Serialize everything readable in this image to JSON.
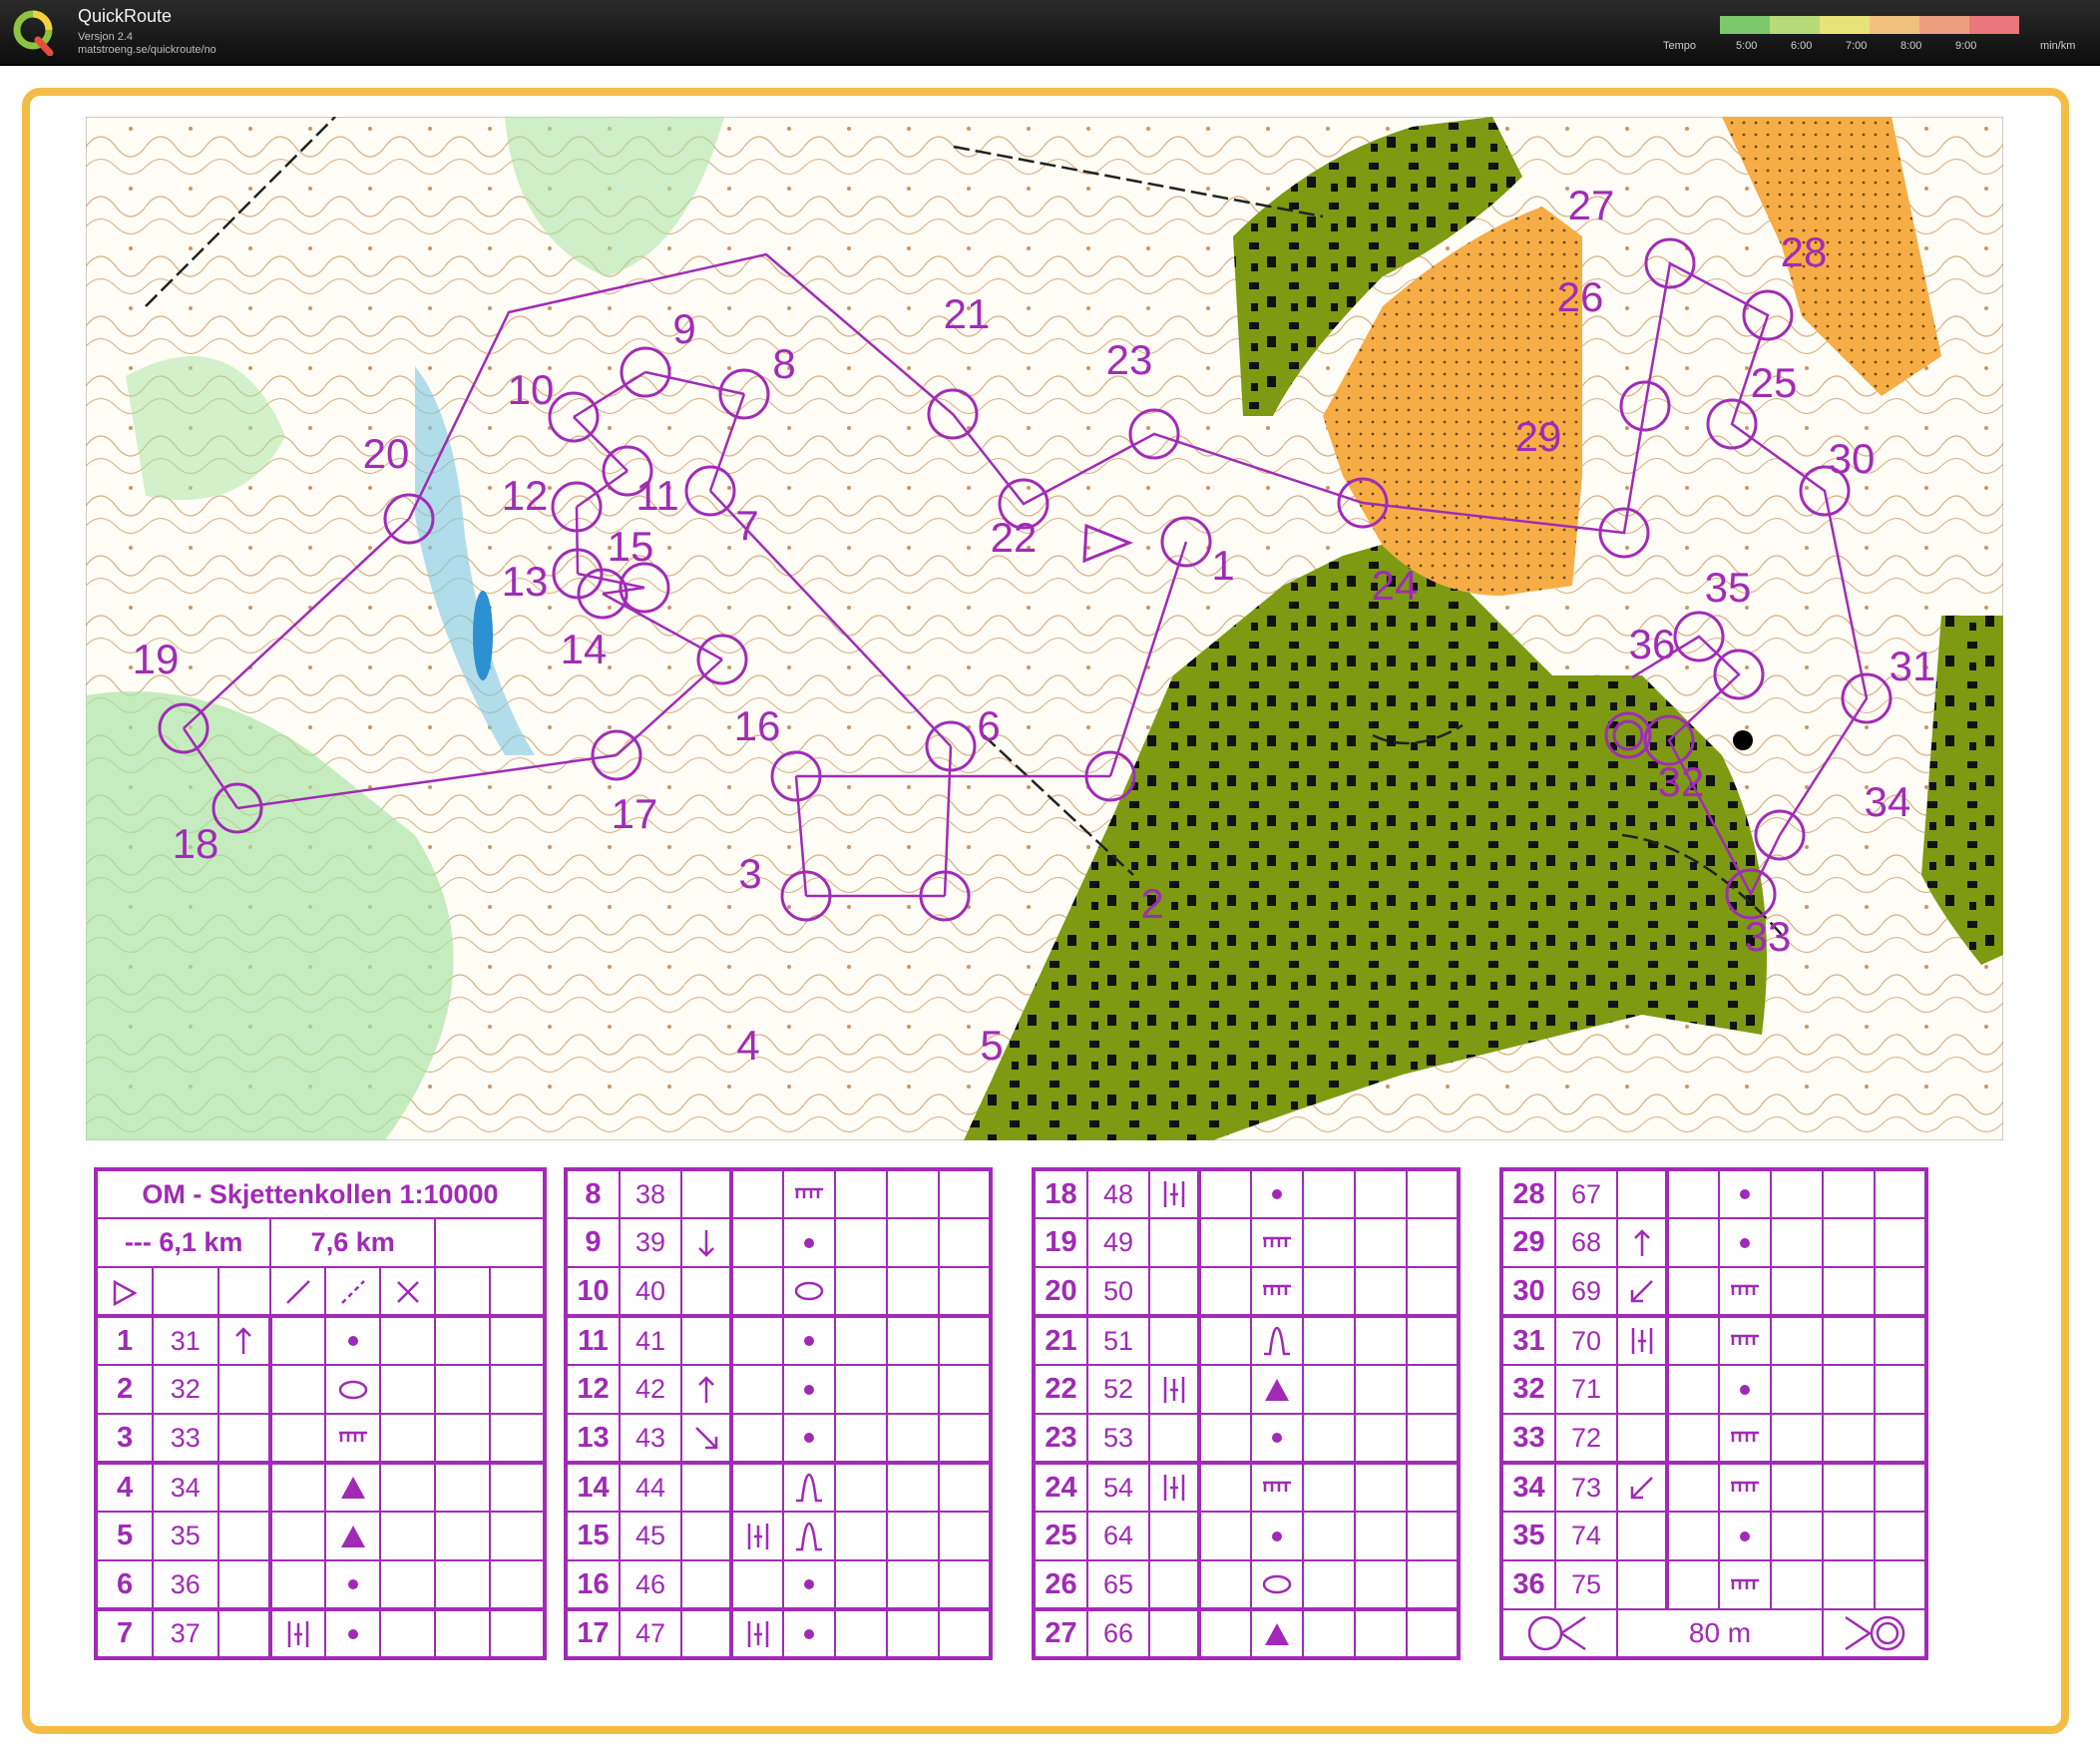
{
  "app": {
    "title": "QuickRoute",
    "version": "Versjon 2.4",
    "url": "matstroeng.se/quickroute/no",
    "tempo_label": "Tempo",
    "tempo_ticks": [
      "5:00",
      "6:00",
      "7:00",
      "8:00",
      "9:00"
    ],
    "tempo_unit": "min/km",
    "tempo_colors": [
      "#7bc96a",
      "#b8db79",
      "#e8e27a",
      "#f2c27c",
      "#ee9f7f",
      "#e8767a"
    ]
  },
  "map": {
    "control_labels": [
      "1",
      "2",
      "3",
      "4",
      "5",
      "6",
      "7",
      "8",
      "9",
      "10",
      "11",
      "12",
      "13",
      "14",
      "15",
      "16",
      "17",
      "18",
      "19",
      "20",
      "21",
      "22",
      "23",
      "24",
      "25",
      "26",
      "27",
      "28",
      "29",
      "30",
      "31",
      "32",
      "33",
      "34",
      "35",
      "36"
    ],
    "colors": {
      "course": "#a12bb7",
      "forest": "#ffffff",
      "open": "#f7ad45",
      "green": "#9fe09a",
      "urban": "#7d9a12",
      "contour": "#b36a2a",
      "water": "#58b8d8"
    }
  },
  "descriptions": {
    "title": "OM - Skjettenkollen 1:10000",
    "length_a": "--- 6,1 km",
    "length_b": "7,6 km",
    "finish_distance": "80 m",
    "rows": [
      {
        "n": "1",
        "c": "31",
        "dir": "up",
        "col": "",
        "f": "dot"
      },
      {
        "n": "2",
        "c": "32",
        "dir": "",
        "col": "",
        "f": "ellipse"
      },
      {
        "n": "3",
        "c": "33",
        "dir": "",
        "col": "",
        "f": "comb"
      },
      {
        "n": "4",
        "c": "34",
        "dir": "",
        "col": "",
        "f": "triangle"
      },
      {
        "n": "5",
        "c": "35",
        "dir": "",
        "col": "",
        "f": "triangle"
      },
      {
        "n": "6",
        "c": "36",
        "dir": "",
        "col": "",
        "f": "dot"
      },
      {
        "n": "7",
        "c": "37",
        "dir": "",
        "col": "bars",
        "f": "dot"
      },
      {
        "n": "8",
        "c": "38",
        "dir": "",
        "col": "",
        "f": "comb"
      },
      {
        "n": "9",
        "c": "39",
        "dir": "down",
        "col": "",
        "f": "dot"
      },
      {
        "n": "10",
        "c": "40",
        "dir": "",
        "col": "",
        "f": "ellipse"
      },
      {
        "n": "11",
        "c": "41",
        "dir": "",
        "col": "",
        "f": "dot"
      },
      {
        "n": "12",
        "c": "42",
        "dir": "up",
        "col": "",
        "f": "dot"
      },
      {
        "n": "13",
        "c": "43",
        "dir": "downright",
        "col": "",
        "f": "dot"
      },
      {
        "n": "14",
        "c": "44",
        "dir": "",
        "col": "",
        "f": "knoll"
      },
      {
        "n": "15",
        "c": "45",
        "dir": "",
        "col": "bars",
        "f": "knoll"
      },
      {
        "n": "16",
        "c": "46",
        "dir": "",
        "col": "",
        "f": "dot"
      },
      {
        "n": "17",
        "c": "47",
        "dir": "",
        "col": "bars",
        "f": "dot"
      },
      {
        "n": "18",
        "c": "48",
        "dir": "bars",
        "col": "",
        "f": "dot"
      },
      {
        "n": "19",
        "c": "49",
        "dir": "",
        "col": "",
        "f": "comb"
      },
      {
        "n": "20",
        "c": "50",
        "dir": "",
        "col": "",
        "f": "comb"
      },
      {
        "n": "21",
        "c": "51",
        "dir": "",
        "col": "",
        "f": "knoll"
      },
      {
        "n": "22",
        "c": "52",
        "dir": "bars",
        "col": "",
        "f": "triangle"
      },
      {
        "n": "23",
        "c": "53",
        "dir": "",
        "col": "",
        "f": "dot"
      },
      {
        "n": "24",
        "c": "54",
        "dir": "bars",
        "col": "",
        "f": "comb"
      },
      {
        "n": "25",
        "c": "64",
        "dir": "",
        "col": "",
        "f": "dot"
      },
      {
        "n": "26",
        "c": "65",
        "dir": "",
        "col": "",
        "f": "ellipse"
      },
      {
        "n": "27",
        "c": "66",
        "dir": "",
        "col": "",
        "f": "triangle"
      },
      {
        "n": "28",
        "c": "67",
        "dir": "",
        "col": "",
        "f": "dot"
      },
      {
        "n": "29",
        "c": "68",
        "dir": "up",
        "col": "",
        "f": "dot"
      },
      {
        "n": "30",
        "c": "69",
        "dir": "downleft",
        "col": "",
        "f": "comb"
      },
      {
        "n": "31",
        "c": "70",
        "dir": "bars",
        "col": "",
        "f": "comb"
      },
      {
        "n": "32",
        "c": "71",
        "dir": "",
        "col": "",
        "f": "dot"
      },
      {
        "n": "33",
        "c": "72",
        "dir": "",
        "col": "",
        "f": "comb"
      },
      {
        "n": "34",
        "c": "73",
        "dir": "downleft",
        "col": "",
        "f": "comb"
      },
      {
        "n": "35",
        "c": "74",
        "dir": "",
        "col": "",
        "f": "dot"
      },
      {
        "n": "36",
        "c": "75",
        "dir": "",
        "col": "",
        "f": "comb"
      }
    ]
  }
}
